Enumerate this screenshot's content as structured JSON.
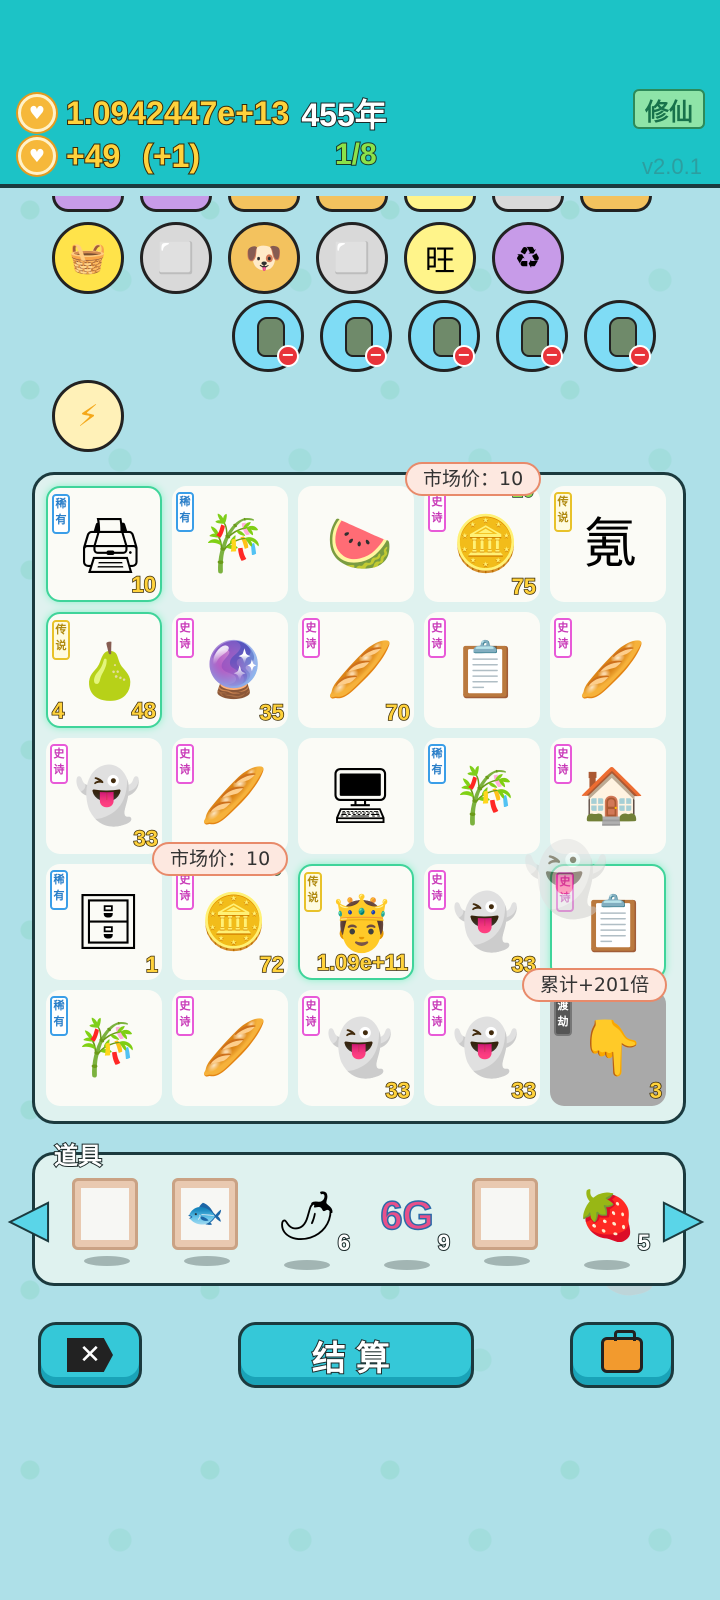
{
  "header": {
    "coins": "1.0942447e+13",
    "years": "455年",
    "income": "+49",
    "bonus": "(+1)",
    "progress": "1/8",
    "xiuxian_label": "修仙",
    "version": "v2.0.1"
  },
  "effects": {
    "row1": [
      {
        "icon": "fruit-basket-icon",
        "glyph": "🧺",
        "bg": "#ffe34a"
      },
      {
        "icon": "tofu-icon",
        "glyph": "⬜",
        "bg": "#d9d9d9"
      },
      {
        "icon": "twin-dogs-icon",
        "glyph": "🐶",
        "bg": "#f3c25e"
      },
      {
        "icon": "tofu-icon",
        "glyph": "⬜",
        "bg": "#d9d9d9"
      },
      {
        "icon": "wang-icon",
        "glyph": "旺",
        "bg": "#fff48a"
      },
      {
        "icon": "recycle-icon",
        "glyph": "♻",
        "bg": "#c79be8"
      }
    ],
    "bag_count": 5,
    "lightning_glyph": "⚡"
  },
  "tooltips": {
    "market_price_1": "市场价：10",
    "market_price_2": "市场价：10",
    "total_multiplier": "累计+201倍"
  },
  "grid": [
    {
      "tag": "稀有",
      "rarity": "rare",
      "icon": "printer-icon",
      "glyph": "🖨",
      "num": "10",
      "glow": true
    },
    {
      "tag": "稀有",
      "rarity": "rare",
      "icon": "bamboo-icon",
      "glyph": "🎋",
      "num": ""
    },
    {
      "tag": "",
      "rarity": "",
      "icon": "watermelon-icon",
      "glyph": "🍉",
      "num": ""
    },
    {
      "tag": "史诗",
      "rarity": "epic",
      "icon": "coin-pizza-icon",
      "glyph": "🪙",
      "num": "75",
      "top": "10"
    },
    {
      "tag": "传说",
      "rarity": "legend",
      "icon": "qi-character-icon",
      "glyph": "氪",
      "num": ""
    },
    {
      "tag": "传说",
      "rarity": "legend",
      "icon": "crown-pear-icon",
      "glyph": "🍐",
      "num": "48",
      "left": "4",
      "glow": true
    },
    {
      "tag": "史诗",
      "rarity": "epic",
      "icon": "capsule-toy-icon",
      "glyph": "🔮",
      "num": "35"
    },
    {
      "tag": "史诗",
      "rarity": "epic",
      "icon": "straw-icon",
      "glyph": "🥖",
      "num": "70"
    },
    {
      "tag": "史诗",
      "rarity": "epic",
      "icon": "copy-paste-icon",
      "glyph": "📋",
      "num": ""
    },
    {
      "tag": "史诗",
      "rarity": "epic",
      "icon": "straw-icon",
      "glyph": "🥖",
      "num": ""
    },
    {
      "tag": "史诗",
      "rarity": "epic",
      "icon": "ghost-icon",
      "glyph": "👻",
      "num": "33"
    },
    {
      "tag": "史诗",
      "rarity": "epic",
      "icon": "straw-icon",
      "glyph": "🥖",
      "num": ""
    },
    {
      "tag": "",
      "rarity": "",
      "icon": "monitor-icon",
      "glyph": "🖥",
      "num": ""
    },
    {
      "tag": "稀有",
      "rarity": "rare",
      "icon": "bamboo-icon",
      "glyph": "🎋",
      "num": ""
    },
    {
      "tag": "史诗",
      "rarity": "epic",
      "icon": "house-icon",
      "glyph": "🏠",
      "num": ""
    },
    {
      "tag": "稀有",
      "rarity": "rare",
      "icon": "server-icon",
      "glyph": "🗄",
      "num": "1"
    },
    {
      "tag": "史诗",
      "rarity": "epic",
      "icon": "coin-pizza-icon",
      "glyph": "🪙",
      "num": "72",
      "top": "10"
    },
    {
      "tag": "传说",
      "rarity": "legend",
      "icon": "king-face-icon",
      "glyph": "🤴",
      "num": "1.09e+11",
      "glow": true
    },
    {
      "tag": "史诗",
      "rarity": "epic",
      "icon": "ghost-icon",
      "glyph": "👻",
      "num": "33"
    },
    {
      "tag": "史诗",
      "rarity": "epic",
      "icon": "copy-paste-icon",
      "glyph": "📋",
      "num": "",
      "glow": true
    },
    {
      "tag": "稀有",
      "rarity": "rare",
      "icon": "bamboo-icon",
      "glyph": "🎋",
      "num": ""
    },
    {
      "tag": "史诗",
      "rarity": "epic",
      "icon": "straw-icon",
      "glyph": "🥖",
      "num": ""
    },
    {
      "tag": "史诗",
      "rarity": "epic",
      "icon": "ghost-icon",
      "glyph": "👻",
      "num": "33"
    },
    {
      "tag": "史诗",
      "rarity": "epic",
      "icon": "ghost-icon",
      "glyph": "👻",
      "num": "33"
    },
    {
      "tag": "渡劫",
      "rarity": "dujie",
      "icon": "pointing-finger-icon",
      "glyph": "👇",
      "num": "3",
      "gray": true
    }
  ],
  "items": {
    "title": "道具",
    "slots": [
      {
        "kind": "frame",
        "icon": "empty-frame-icon",
        "glyph": ""
      },
      {
        "kind": "frame",
        "icon": "koi-fish-icon",
        "glyph": "🐟"
      },
      {
        "kind": "glyph",
        "icon": "chili-icon",
        "glyph": "🌶",
        "count": "6"
      },
      {
        "kind": "text",
        "icon": "6g-icon",
        "glyph": "6G",
        "count": "9"
      },
      {
        "kind": "frame",
        "icon": "empty-frame-icon",
        "glyph": ""
      },
      {
        "kind": "glyph",
        "icon": "strawberry-icon",
        "glyph": "🍓",
        "count": "5"
      }
    ]
  },
  "buttons": {
    "settle_label": "结算"
  }
}
